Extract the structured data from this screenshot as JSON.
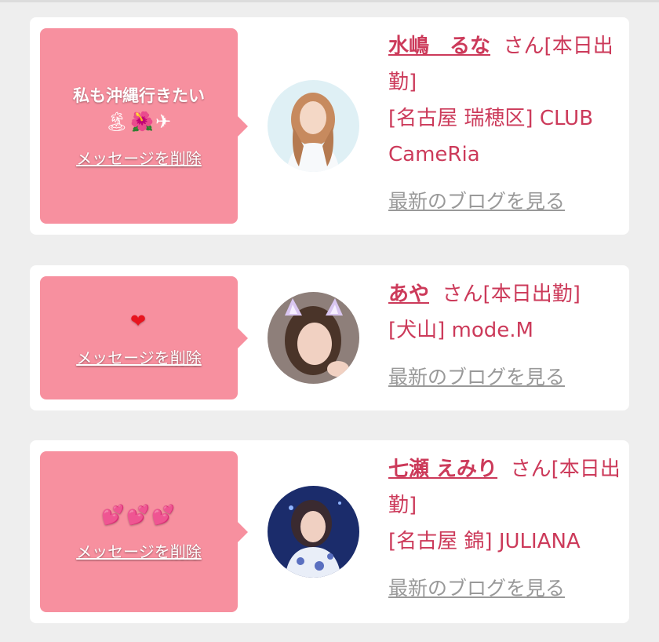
{
  "accent_color": "#cc3a5a",
  "bubble_color": "#f7909f",
  "cards": [
    {
      "message": "私も沖縄行きたい",
      "emoji": "🏝🌺✈",
      "delete_label": "メッセージを削除",
      "name": "水嶋　るな",
      "name_suffix": "さん[本日出勤]",
      "shop": "[名古屋 瑞穂区] CLUB CameRia",
      "blog_label": "最新のブログを見る"
    },
    {
      "message": "",
      "emoji": "❤",
      "delete_label": "メッセージを削除",
      "name": "あや",
      "name_suffix": "さん[本日出勤]",
      "shop": "[犬山] mode.M",
      "blog_label": "最新のブログを見る"
    },
    {
      "message": "",
      "emoji": "💕💕💕",
      "delete_label": "メッセージを削除",
      "name": "七瀬 えみり",
      "name_suffix": "さん[本日出勤]",
      "shop": "[名古屋 錦] JULIANA",
      "blog_label": "最新のブログを見る"
    }
  ]
}
